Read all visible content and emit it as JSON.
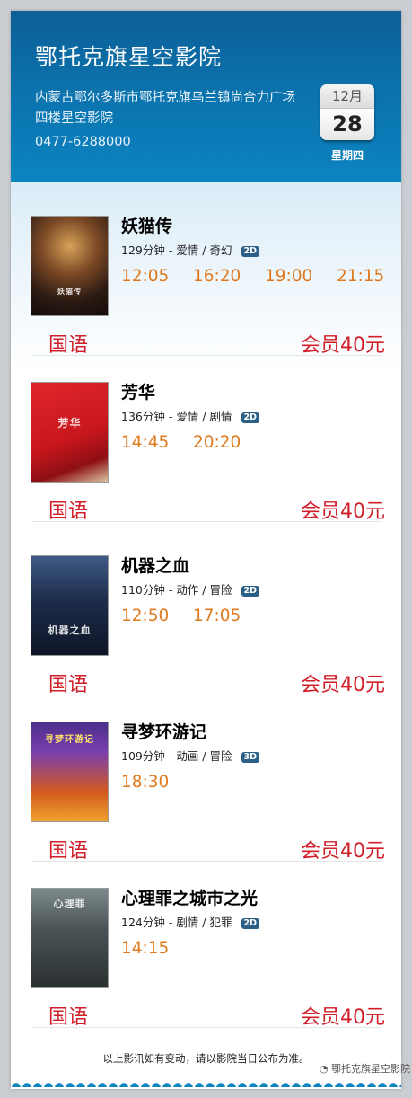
{
  "cinema": {
    "name": "鄂托克旗星空影院",
    "address": "内蒙古鄂尔多斯市鄂托克旗乌兰镇尚合力广场四楼星空影院",
    "phone": "0477-6288000"
  },
  "date": {
    "month": "12月",
    "day": "28",
    "weekday": "星期四"
  },
  "movies": [
    {
      "title": "妖猫传",
      "duration": "129分钟",
      "genre": "爱情 / 奇幻",
      "format": "2D",
      "times": [
        "12:05",
        "16:20",
        "19:00",
        "21:15"
      ],
      "language": "国语",
      "price": "会员40元"
    },
    {
      "title": "芳华",
      "duration": "136分钟",
      "genre": "爱情 / 剧情",
      "format": "2D",
      "times": [
        "14:45",
        "20:20"
      ],
      "language": "国语",
      "price": "会员40元"
    },
    {
      "title": "机器之血",
      "duration": "110分钟",
      "genre": "动作 / 冒险",
      "format": "2D",
      "times": [
        "12:50",
        "17:05"
      ],
      "language": "国语",
      "price": "会员40元"
    },
    {
      "title": "寻梦环游记",
      "duration": "109分钟",
      "genre": "动画 / 冒险",
      "format": "3D",
      "times": [
        "18:30"
      ],
      "language": "国语",
      "price": "会员40元"
    },
    {
      "title": "心理罪之城市之光",
      "duration": "124分钟",
      "genre": "剧情 / 犯罪",
      "format": "2D",
      "times": [
        "14:15"
      ],
      "language": "国语",
      "price": "会员40元"
    }
  ],
  "footer": {
    "note": "以上影讯如有变动，请以影院当日公布为准。"
  },
  "watermark": "鄂托克旗星空影院",
  "colors": {
    "header": "#0b75b0",
    "showtime": "#e07a1e",
    "price": "#d11f2a",
    "badge": "#2c5f86"
  }
}
